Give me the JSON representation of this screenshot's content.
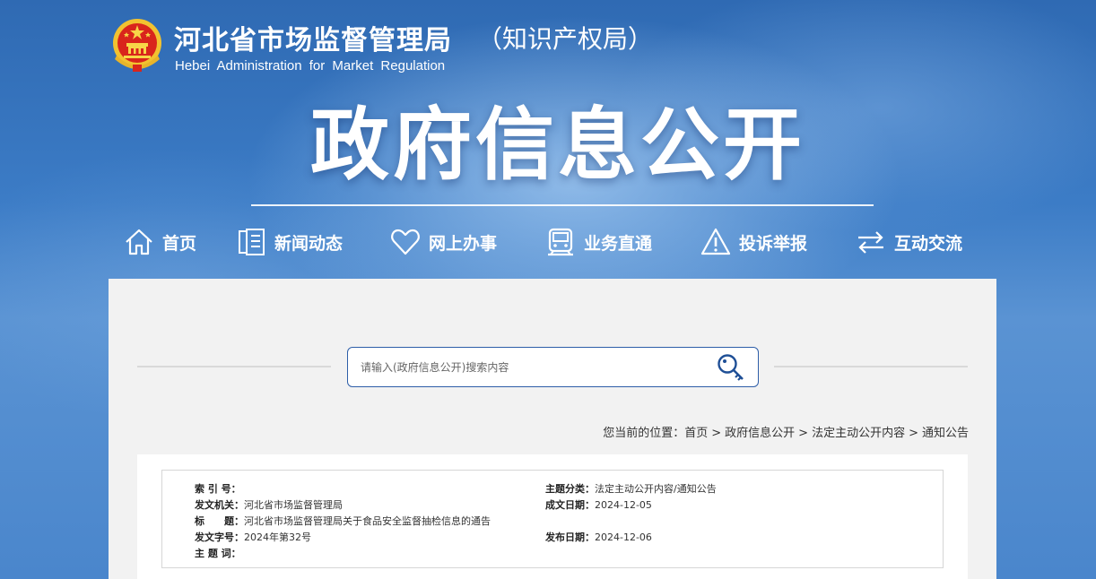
{
  "header": {
    "title": "河北省市场监督管理局",
    "subtitle": "（知识产权局）",
    "english": "Hebei Administration for Market Regulation",
    "emblem_icon": "national-emblem-icon"
  },
  "banner": {
    "title": "政府信息公开"
  },
  "nav": {
    "items": [
      {
        "label": "首页",
        "icon": "home-icon"
      },
      {
        "label": "新闻动态",
        "icon": "document-icon"
      },
      {
        "label": "网上办事",
        "icon": "heart-icon"
      },
      {
        "label": "业务直通",
        "icon": "train-icon"
      },
      {
        "label": "投诉举报",
        "icon": "warning-icon"
      },
      {
        "label": "互动交流",
        "icon": "exchange-icon"
      }
    ]
  },
  "search": {
    "placeholder": "请输入(政府信息公开)搜索内容",
    "value": "",
    "icon": "search-key-icon"
  },
  "breadcrumb": {
    "prefix": "您当前的位置：",
    "items": [
      "首页",
      "政府信息公开",
      "法定主动公开内容",
      "通知公告"
    ],
    "separator": ">"
  },
  "info": {
    "index_no": {
      "label": "索 引 号：",
      "value": ""
    },
    "issuer": {
      "label": "发文机关：",
      "value": "河北省市场监督管理局"
    },
    "title": {
      "label": "标　　题：",
      "value": "河北省市场监督管理局关于食品安全监督抽检信息的通告"
    },
    "doc_no": {
      "label": "发文字号：",
      "value": "2024年第32号"
    },
    "keywords": {
      "label": "主 题 词：",
      "value": ""
    },
    "category": {
      "label": "主题分类：",
      "value": "法定主动公开内容/通知公告"
    },
    "created": {
      "label": "成文日期：",
      "value": "2024-12-05"
    },
    "published": {
      "label": "发布日期：",
      "value": "2024-12-06"
    }
  },
  "colors": {
    "brand_blue": "#3c7cc6",
    "search_border": "#2e5ea8",
    "panel_bg": "#f2f2f2"
  }
}
